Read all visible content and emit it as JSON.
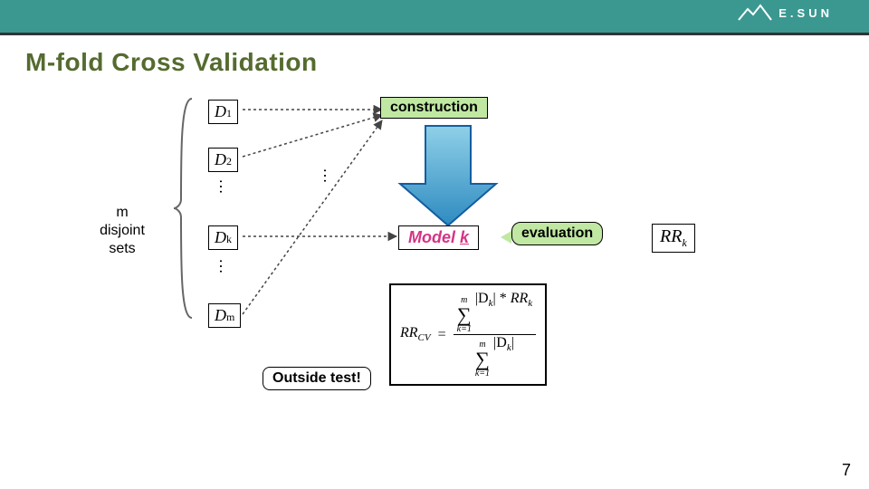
{
  "header": {
    "brand": "E.SUN"
  },
  "title": "M-fold Cross Validation",
  "labels": {
    "m_disjoint_sets": "m\ndisjoint\nsets",
    "construction": "construction",
    "model_k_prefix": "Model ",
    "model_k_suffix": "k",
    "evaluation": "evaluation",
    "outside_test": "Outside test!"
  },
  "sets": {
    "d1": "D",
    "d1_sub": "1",
    "d2": "D",
    "d2_sub": "2",
    "dk": "D",
    "dk_sub": "k",
    "dm": "D",
    "dm_sub": "m"
  },
  "rrk": {
    "label": "RR",
    "sub": "k"
  },
  "formula": {
    "lhs": "RR",
    "lhs_sub": "CV",
    "eq": "=",
    "sum_top": "m",
    "sum_bottom": "k=1",
    "num_abs_left": "|D",
    "num_abs_sub": "k",
    "num_abs_right": "|",
    "star": " * ",
    "num_rr": "RR",
    "num_rr_sub": "k",
    "den_abs_left": "|D",
    "den_abs_sub": "k",
    "den_abs_right": "|"
  },
  "page": "7",
  "dots": "…"
}
